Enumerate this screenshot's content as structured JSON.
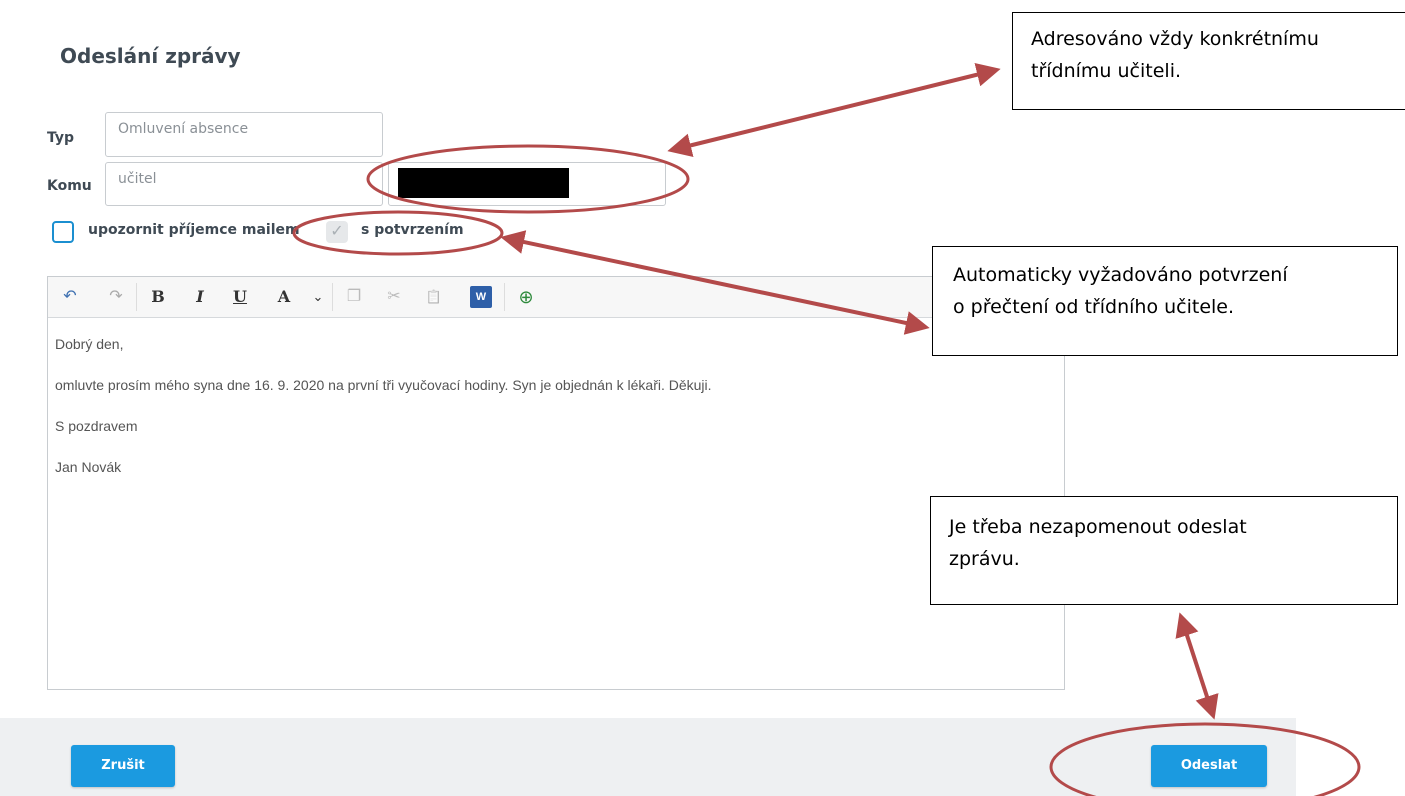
{
  "form": {
    "title": "Odeslání zprávy",
    "type_label": "Typ",
    "type_value": "Omluvení absence",
    "to_label": "Komu",
    "to_value": "učitel",
    "notify_label": "upozornit příjemce mailem",
    "notify_checked": false,
    "confirm_label": "s potvrzením",
    "confirm_checked": true
  },
  "toolbar": {
    "undo": "↶",
    "redo": "↷",
    "bold": "B",
    "italic": "I",
    "underline": "U",
    "font_color": "A",
    "dropdown": "⌄",
    "copy": "❐",
    "cut": "✂",
    "paste": "📋",
    "paste_word": "W",
    "link": "⊕"
  },
  "message": {
    "lines": [
      "Dobrý den,",
      "omluvte prosím mého syna dne 16. 9. 2020 na první tři vyučovací hodiny. Syn je objednán k lékaři. Děkuji.",
      "S pozdravem",
      "Jan Novák"
    ]
  },
  "buttons": {
    "cancel": "Zrušit",
    "send": "Odeslat"
  },
  "annotations": {
    "callout_recipient": [
      "Adresováno vždy konkrétnímu",
      "třídnímu učiteli."
    ],
    "callout_confirm": [
      "Automaticky vyžadováno potvrzení",
      "o přečtení od třídního učitele."
    ],
    "callout_send": [
      "Je třeba nezapomenout odeslat",
      "zprávu."
    ],
    "accent_color": "#1b9ae0",
    "annotation_color": "#b34a4a"
  }
}
